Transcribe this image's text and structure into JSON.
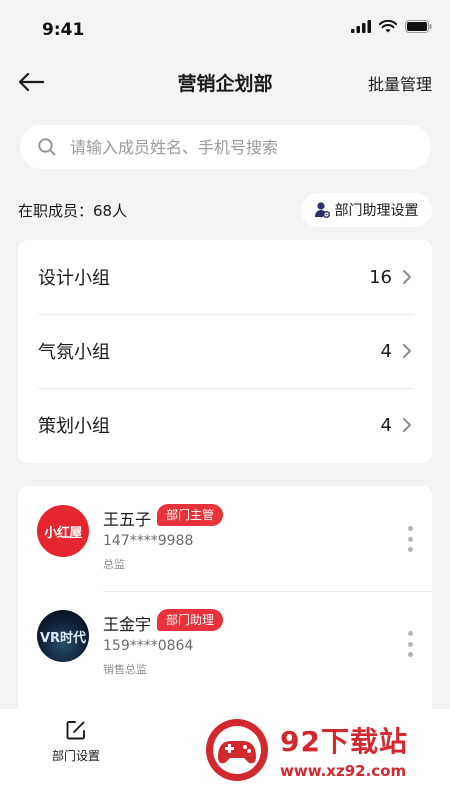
{
  "status_bar": {
    "time": "9:41"
  },
  "nav": {
    "title": "营销企划部",
    "action": "批量管理"
  },
  "search": {
    "placeholder": "请输入成员姓名、手机号搜索"
  },
  "summary": {
    "active_members": "在职成员：68人",
    "assistant_settings": "部门助理设置"
  },
  "groups": [
    {
      "name": "设计小组",
      "count": "16"
    },
    {
      "name": "气氛小组",
      "count": "4"
    },
    {
      "name": "策划小组",
      "count": "4"
    }
  ],
  "members": [
    {
      "name": "王五子",
      "tag": "部门主管",
      "phone": "147****9988",
      "title": "总监",
      "avatar_text": "小红屋"
    },
    {
      "name": "王金宇",
      "tag": "部门助理",
      "phone": "159****0864",
      "title": "销售总监",
      "avatar_text": "VR时代"
    }
  ],
  "bottom": {
    "dept_settings": "部门设置"
  },
  "watermark": {
    "title": "92下载站",
    "url": "www.xz92.com"
  },
  "colors": {
    "accent_red": "#e9323a",
    "background": "#f3f3f6",
    "card": "#ffffff"
  }
}
